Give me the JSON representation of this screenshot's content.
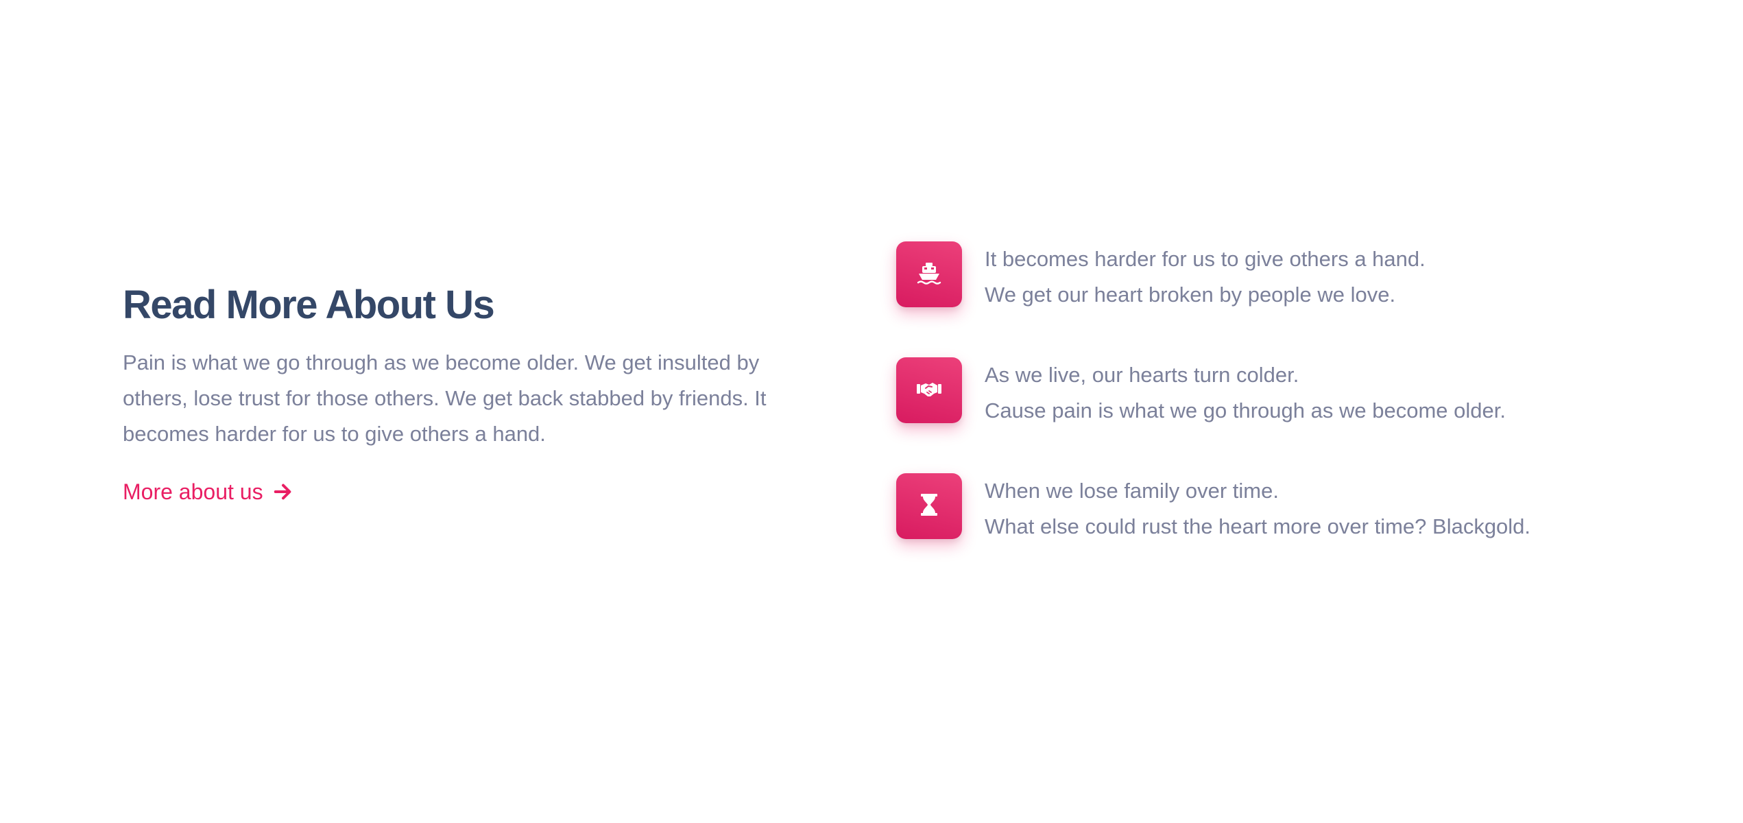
{
  "section": {
    "title": "Read More About Us",
    "description": "Pain is what we go through as we become older. We get insulted by others, lose trust for those others. We get back stabbed by friends. It becomes harder for us to give others a hand.",
    "more_link": "More about us",
    "more_link_icon": "arrow-right-icon"
  },
  "features": [
    {
      "icon": "ship-icon",
      "line1": "It becomes harder for us to give others a hand.",
      "line2": "We get our heart broken by people we love."
    },
    {
      "icon": "handshake-icon",
      "line1": "As we live, our hearts turn colder.",
      "line2": "Cause pain is what we go through as we become older."
    },
    {
      "icon": "hourglass-icon",
      "line1": "When we lose family over time.",
      "line2": "What else could rust the heart more over time? Blackgold."
    }
  ],
  "colors": {
    "accent": "#e91e63",
    "heading": "#344767",
    "body_text": "#7b809a",
    "background": "#ffffff"
  }
}
